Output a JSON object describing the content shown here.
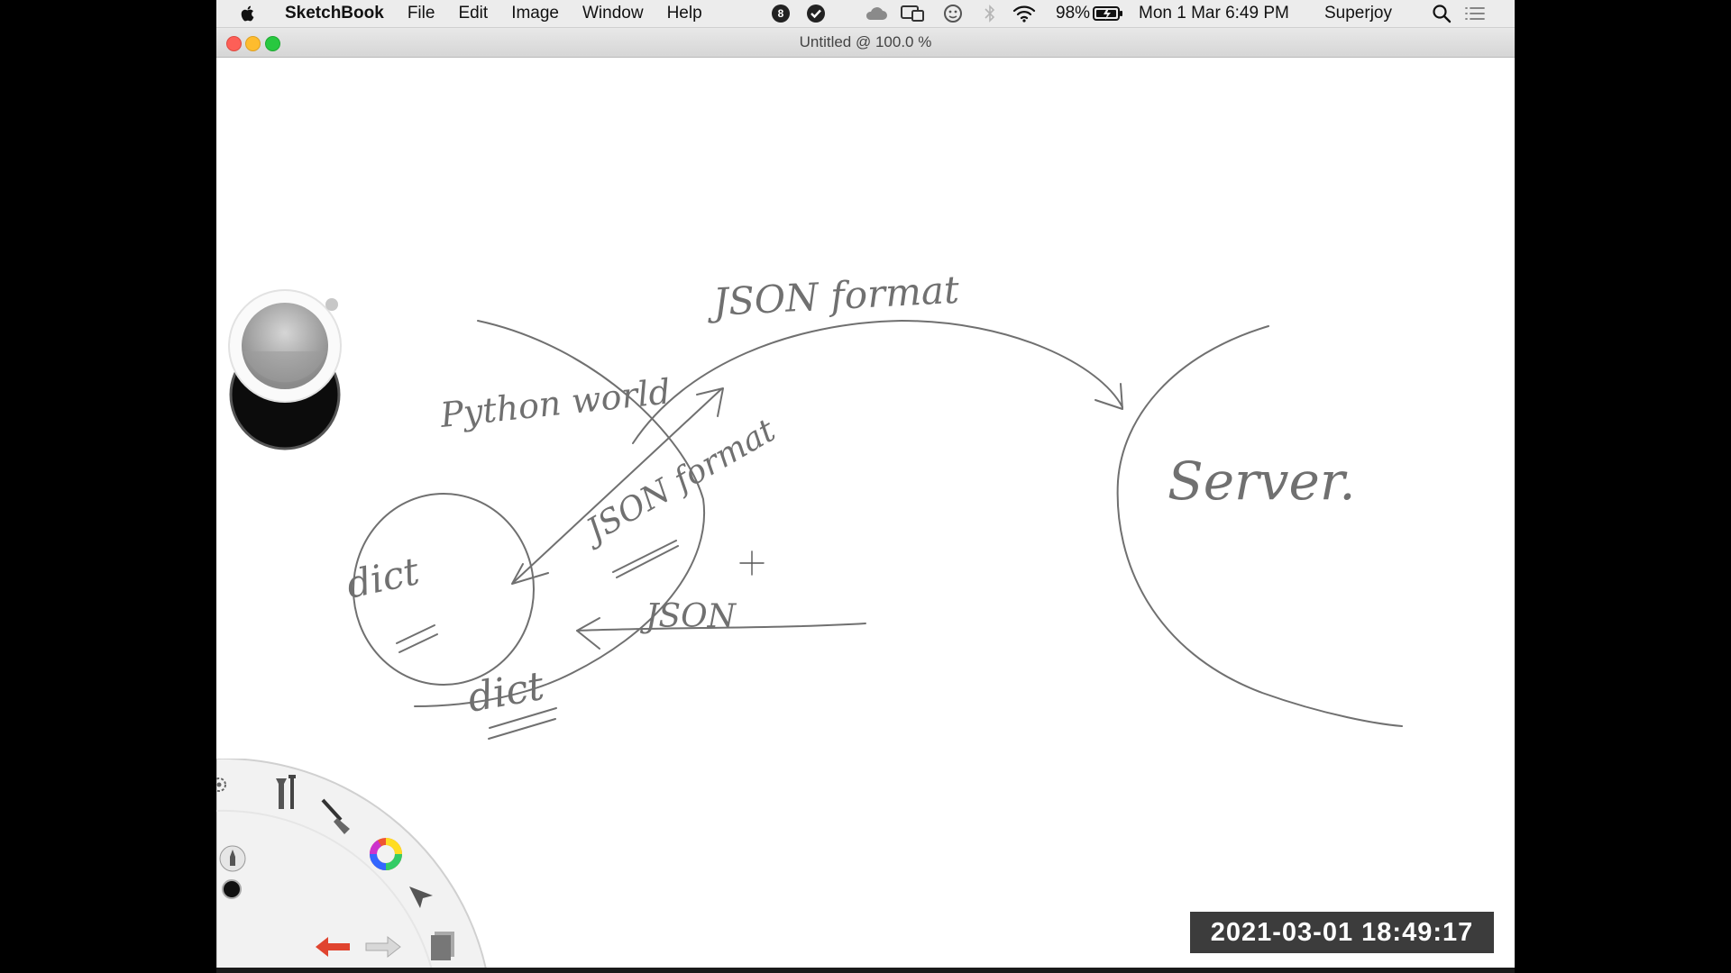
{
  "menubar": {
    "app_name": "SketchBook",
    "menus": [
      "File",
      "Edit",
      "Image",
      "Window",
      "Help"
    ],
    "status_badge": "8",
    "battery": "98%",
    "datetime": "Mon 1 Mar  6:49 PM",
    "user": "Superjoy"
  },
  "window": {
    "title": "Untitled @ 100.0 %"
  },
  "canvas": {
    "handwriting": {
      "json_format_top": "JSON format",
      "python_world": "Python world",
      "server": "Server.",
      "json_format_mid": "JSON format",
      "dict_inner": "dict",
      "json_bottom": "JSON",
      "dict_outer": "dict"
    }
  },
  "overlay": {
    "timestamp": "2021-03-01  18:49:17"
  },
  "colors": {
    "ink": "#6f6f6f",
    "close": "#fd5f57",
    "minimize": "#febc2e",
    "zoom": "#28c840",
    "undo": "#e0442f"
  }
}
